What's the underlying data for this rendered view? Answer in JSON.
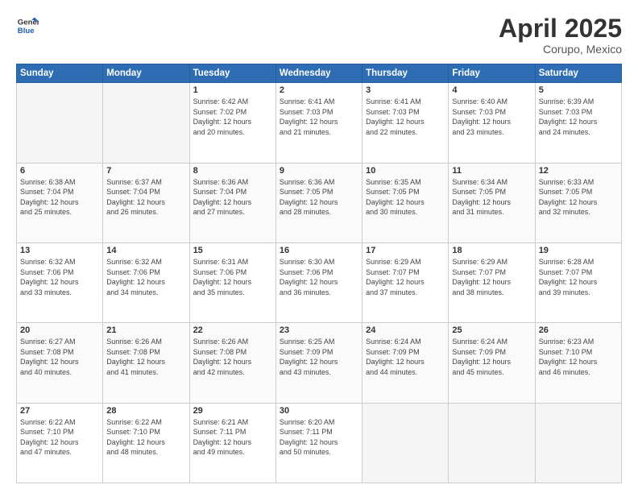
{
  "header": {
    "logo_line1": "General",
    "logo_line2": "Blue",
    "title": "April 2025",
    "location": "Corupo, Mexico"
  },
  "days_of_week": [
    "Sunday",
    "Monday",
    "Tuesday",
    "Wednesday",
    "Thursday",
    "Friday",
    "Saturday"
  ],
  "weeks": [
    [
      {
        "num": "",
        "info": "",
        "empty": true
      },
      {
        "num": "",
        "info": "",
        "empty": true
      },
      {
        "num": "1",
        "info": "Sunrise: 6:42 AM\nSunset: 7:02 PM\nDaylight: 12 hours\nand 20 minutes."
      },
      {
        "num": "2",
        "info": "Sunrise: 6:41 AM\nSunset: 7:03 PM\nDaylight: 12 hours\nand 21 minutes."
      },
      {
        "num": "3",
        "info": "Sunrise: 6:41 AM\nSunset: 7:03 PM\nDaylight: 12 hours\nand 22 minutes."
      },
      {
        "num": "4",
        "info": "Sunrise: 6:40 AM\nSunset: 7:03 PM\nDaylight: 12 hours\nand 23 minutes."
      },
      {
        "num": "5",
        "info": "Sunrise: 6:39 AM\nSunset: 7:03 PM\nDaylight: 12 hours\nand 24 minutes."
      }
    ],
    [
      {
        "num": "6",
        "info": "Sunrise: 6:38 AM\nSunset: 7:04 PM\nDaylight: 12 hours\nand 25 minutes."
      },
      {
        "num": "7",
        "info": "Sunrise: 6:37 AM\nSunset: 7:04 PM\nDaylight: 12 hours\nand 26 minutes."
      },
      {
        "num": "8",
        "info": "Sunrise: 6:36 AM\nSunset: 7:04 PM\nDaylight: 12 hours\nand 27 minutes."
      },
      {
        "num": "9",
        "info": "Sunrise: 6:36 AM\nSunset: 7:05 PM\nDaylight: 12 hours\nand 28 minutes."
      },
      {
        "num": "10",
        "info": "Sunrise: 6:35 AM\nSunset: 7:05 PM\nDaylight: 12 hours\nand 30 minutes."
      },
      {
        "num": "11",
        "info": "Sunrise: 6:34 AM\nSunset: 7:05 PM\nDaylight: 12 hours\nand 31 minutes."
      },
      {
        "num": "12",
        "info": "Sunrise: 6:33 AM\nSunset: 7:05 PM\nDaylight: 12 hours\nand 32 minutes."
      }
    ],
    [
      {
        "num": "13",
        "info": "Sunrise: 6:32 AM\nSunset: 7:06 PM\nDaylight: 12 hours\nand 33 minutes."
      },
      {
        "num": "14",
        "info": "Sunrise: 6:32 AM\nSunset: 7:06 PM\nDaylight: 12 hours\nand 34 minutes."
      },
      {
        "num": "15",
        "info": "Sunrise: 6:31 AM\nSunset: 7:06 PM\nDaylight: 12 hours\nand 35 minutes."
      },
      {
        "num": "16",
        "info": "Sunrise: 6:30 AM\nSunset: 7:06 PM\nDaylight: 12 hours\nand 36 minutes."
      },
      {
        "num": "17",
        "info": "Sunrise: 6:29 AM\nSunset: 7:07 PM\nDaylight: 12 hours\nand 37 minutes."
      },
      {
        "num": "18",
        "info": "Sunrise: 6:29 AM\nSunset: 7:07 PM\nDaylight: 12 hours\nand 38 minutes."
      },
      {
        "num": "19",
        "info": "Sunrise: 6:28 AM\nSunset: 7:07 PM\nDaylight: 12 hours\nand 39 minutes."
      }
    ],
    [
      {
        "num": "20",
        "info": "Sunrise: 6:27 AM\nSunset: 7:08 PM\nDaylight: 12 hours\nand 40 minutes."
      },
      {
        "num": "21",
        "info": "Sunrise: 6:26 AM\nSunset: 7:08 PM\nDaylight: 12 hours\nand 41 minutes."
      },
      {
        "num": "22",
        "info": "Sunrise: 6:26 AM\nSunset: 7:08 PM\nDaylight: 12 hours\nand 42 minutes."
      },
      {
        "num": "23",
        "info": "Sunrise: 6:25 AM\nSunset: 7:09 PM\nDaylight: 12 hours\nand 43 minutes."
      },
      {
        "num": "24",
        "info": "Sunrise: 6:24 AM\nSunset: 7:09 PM\nDaylight: 12 hours\nand 44 minutes."
      },
      {
        "num": "25",
        "info": "Sunrise: 6:24 AM\nSunset: 7:09 PM\nDaylight: 12 hours\nand 45 minutes."
      },
      {
        "num": "26",
        "info": "Sunrise: 6:23 AM\nSunset: 7:10 PM\nDaylight: 12 hours\nand 46 minutes."
      }
    ],
    [
      {
        "num": "27",
        "info": "Sunrise: 6:22 AM\nSunset: 7:10 PM\nDaylight: 12 hours\nand 47 minutes."
      },
      {
        "num": "28",
        "info": "Sunrise: 6:22 AM\nSunset: 7:10 PM\nDaylight: 12 hours\nand 48 minutes."
      },
      {
        "num": "29",
        "info": "Sunrise: 6:21 AM\nSunset: 7:11 PM\nDaylight: 12 hours\nand 49 minutes."
      },
      {
        "num": "30",
        "info": "Sunrise: 6:20 AM\nSunset: 7:11 PM\nDaylight: 12 hours\nand 50 minutes."
      },
      {
        "num": "",
        "info": "",
        "empty": true
      },
      {
        "num": "",
        "info": "",
        "empty": true
      },
      {
        "num": "",
        "info": "",
        "empty": true
      }
    ]
  ]
}
